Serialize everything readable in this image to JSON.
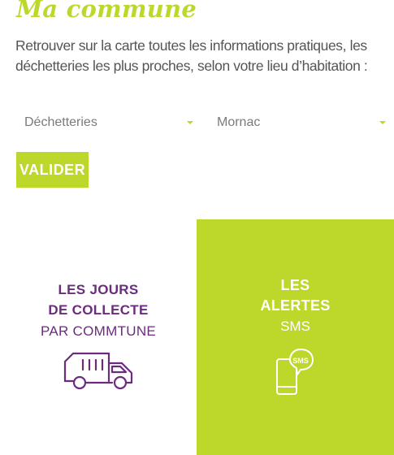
{
  "page": {
    "title": "Ma commune",
    "intro": "Retrouver sur la carte toutes les informations pratiques, les déchetteries les plus proches, selon votre lieu d’habitation :"
  },
  "form": {
    "type_select": {
      "value": "Déchetteries"
    },
    "city_select": {
      "value": "Mornac"
    },
    "submit_label": "VALIDER"
  },
  "cards": {
    "collection": {
      "line1": "LES JOURS",
      "line2": "DE COLLECTE",
      "line3": "PAR COMMTUNE",
      "icon": "truck-icon"
    },
    "alerts": {
      "line1": "LES",
      "line2": "ALERTES",
      "line3": "SMS",
      "icon": "phone-sms-icon",
      "badge_text": "SMS"
    }
  },
  "colors": {
    "accent": "#bdd82b",
    "purple": "#6b2c7e",
    "text": "#555555",
    "white": "#ffffff"
  }
}
